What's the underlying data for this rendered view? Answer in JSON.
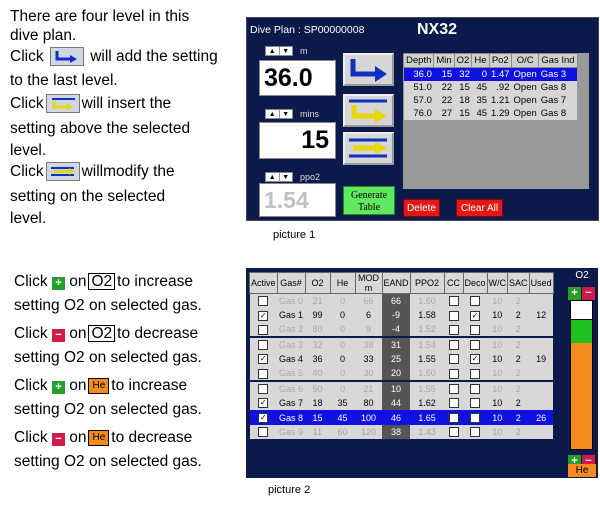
{
  "instructions_top": {
    "line1": "There are four level in this",
    "line2": "dive plan.",
    "l3_pre": "Click",
    "l3_post": "will add the setting",
    "line4": "to the last level.",
    "l5_pre": "Click",
    "l5_post": "will insert the",
    "line6": "setting above the selected",
    "line7": "level.",
    "l8_pre": "Click",
    "l8_post": "willmodify the",
    "line9": "setting  on the selected",
    "line10": "level."
  },
  "picture1": {
    "title": "Dive Plan :  SP00000008",
    "gas_name": "NX32",
    "depth_unit": "m",
    "depth_value": "36.0",
    "time_unit": "mins",
    "time_value": "15",
    "ppo2_unit": "ppo2",
    "ppo2_value": "1.54",
    "generate_btn": "Generate Table",
    "delete_btn": "Delete",
    "clear_btn": "Clear All",
    "caption": "picture 1",
    "columns": [
      "Depth",
      "Min",
      "O2",
      "He",
      "Po2",
      "O/C",
      "Gas Ind"
    ],
    "levels": [
      [
        "36.0",
        "15",
        "32",
        "0",
        "1.47",
        "Open",
        "Gas 3"
      ],
      [
        "51.0",
        "22",
        "15",
        "45",
        ".92",
        "Open",
        "Gas 8"
      ],
      [
        "57.0",
        "22",
        "18",
        "35",
        "1.21",
        "Open",
        "Gas 7"
      ],
      [
        "76.0",
        "27",
        "15",
        "45",
        "1.29",
        "Open",
        "Gas 8"
      ]
    ],
    "selected_level": 0
  },
  "instructions_bottom": {
    "b1_pre": "Click",
    "b1_mid": "on",
    "b1_box": "O2",
    "b1_post": "to increase",
    "b1_line2": "setting O2 on selected gas.",
    "b2_pre": "Click",
    "b2_mid": "on",
    "b2_box": "O2",
    "b2_post": "to decrease",
    "b2_line2": "setting O2 on selected gas.",
    "b3_pre": "Click",
    "b3_mid": "on",
    "b3_box": "He",
    "b3_post": "to increase",
    "b3_line2": "setting O2 on selected gas.",
    "b4_pre": "Click",
    "b4_mid": "on",
    "b4_box": "He",
    "b4_post": "to decrease",
    "b4_line2": "setting O2 on selected gas."
  },
  "picture2": {
    "caption": "picture 2",
    "columns": [
      "Active",
      "Gas#",
      "O2",
      "He",
      "MOD m",
      "EAND",
      "PPO2",
      "CC",
      "Deco",
      "W/C",
      "SAC",
      "Used"
    ],
    "rows": [
      {
        "active": false,
        "gas": "Gas 0",
        "o2": "21",
        "he": "0",
        "mod": "66",
        "eand": "66",
        "ppo2": "1.60",
        "cc": false,
        "deco": false,
        "wc": "10",
        "sac": "2",
        "used": "",
        "dim": true
      },
      {
        "active": true,
        "gas": "Gas 1",
        "o2": "99",
        "he": "0",
        "mod": "6",
        "eand": "-9",
        "ppo2": "1.58",
        "cc": false,
        "deco": true,
        "wc": "10",
        "sac": "2",
        "used": "12",
        "dim": false
      },
      {
        "active": false,
        "gas": "Gas 2",
        "o2": "80",
        "he": "0",
        "mod": "9",
        "eand": "-4",
        "ppo2": "1.52",
        "cc": false,
        "deco": false,
        "wc": "10",
        "sac": "2",
        "used": "",
        "dim": true
      },
      {
        "active": false,
        "gas": "Gas 3",
        "o2": "32",
        "he": "0",
        "mod": "38",
        "eand": "31",
        "ppo2": "1.54",
        "cc": false,
        "deco": false,
        "wc": "10",
        "sac": "2",
        "used": "",
        "dim": true
      },
      {
        "active": true,
        "gas": "Gas 4",
        "o2": "36",
        "he": "0",
        "mod": "33",
        "eand": "25",
        "ppo2": "1.55",
        "cc": false,
        "deco": true,
        "wc": "10",
        "sac": "2",
        "used": "19",
        "dim": false
      },
      {
        "active": false,
        "gas": "Gas 5",
        "o2": "40",
        "he": "0",
        "mod": "30",
        "eand": "20",
        "ppo2": "1.60",
        "cc": false,
        "deco": false,
        "wc": "10",
        "sac": "2",
        "used": "",
        "dim": true
      },
      {
        "active": false,
        "gas": "Gas 6",
        "o2": "50",
        "he": "0",
        "mod": "21",
        "eand": "10",
        "ppo2": "1.55",
        "cc": false,
        "deco": false,
        "wc": "10",
        "sac": "2",
        "used": "",
        "dim": true
      },
      {
        "active": true,
        "gas": "Gas 7",
        "o2": "18",
        "he": "35",
        "mod": "80",
        "eand": "44",
        "ppo2": "1.62",
        "cc": false,
        "deco": false,
        "wc": "10",
        "sac": "2",
        "used": "",
        "dim": false
      },
      {
        "active": true,
        "gas": "Gas 8",
        "o2": "15",
        "he": "45",
        "mod": "100",
        "eand": "46",
        "ppo2": "1.65",
        "cc": false,
        "deco": false,
        "wc": "10",
        "sac": "2",
        "used": "26",
        "dim": false
      },
      {
        "active": false,
        "gas": "Gas 9",
        "o2": "11",
        "he": "60",
        "mod": "120",
        "eand": "38",
        "ppo2": "1.43",
        "cc": false,
        "deco": false,
        "wc": "10",
        "sac": "2",
        "used": "",
        "dim": true
      }
    ],
    "selected_row": 8,
    "o2_label": "O2",
    "he_label": "He",
    "bar_o2_percent": 15,
    "bar_he_percent": 45
  },
  "colors": {
    "panel_bg": "#0b1a4a",
    "selected": "#1010e0",
    "o2_bar": "#20c020",
    "he_bar": "#f28a1c",
    "red_button": "#e01818",
    "generate_button": "#60e860"
  }
}
